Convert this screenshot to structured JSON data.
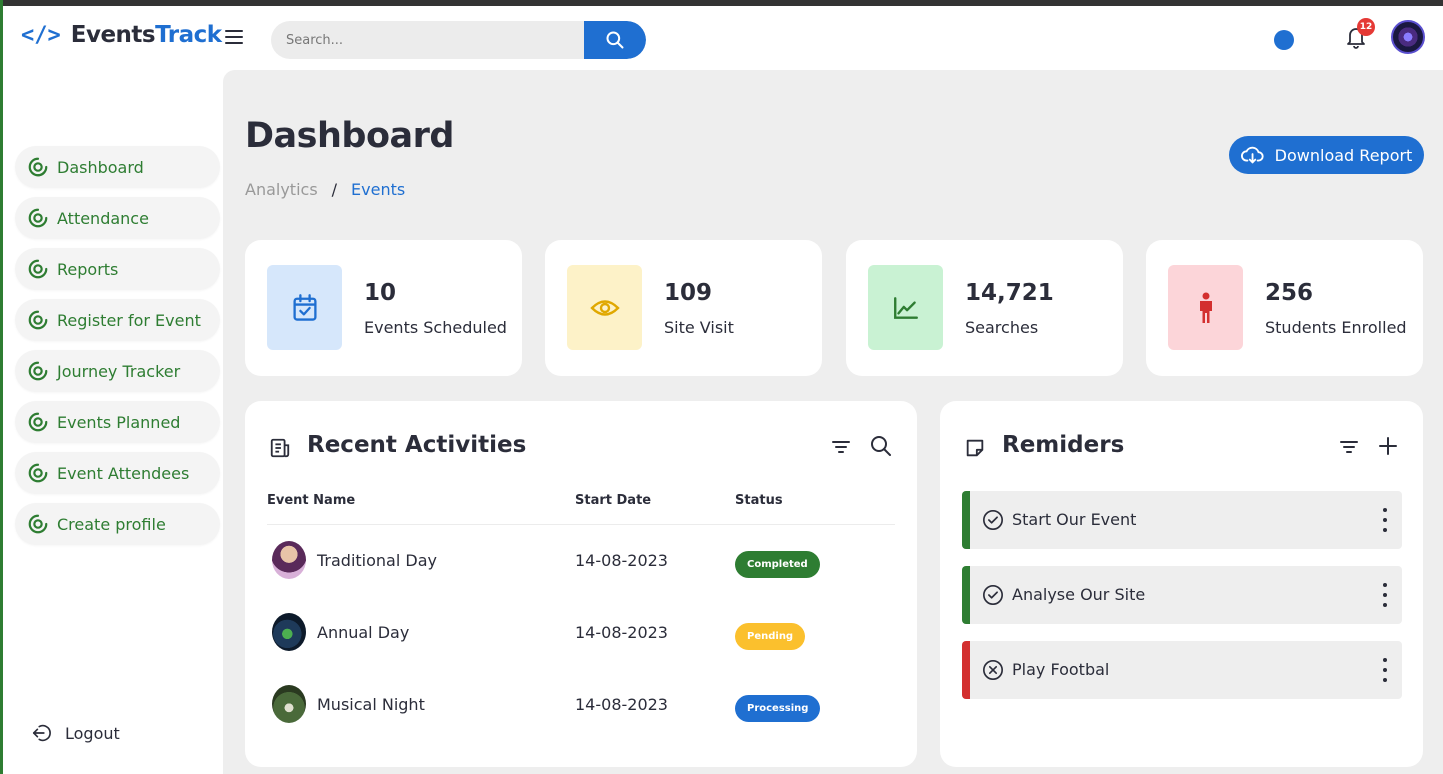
{
  "brand": {
    "icon": "</>",
    "name_main": "Events",
    "name_accent": "Track"
  },
  "header": {
    "search_placeholder": "Search...",
    "notification_count": "12",
    "status_dot_color": "#1f6fd1"
  },
  "sidebar": {
    "items": [
      {
        "label": "Dashboard",
        "icon": "ring-target-icon"
      },
      {
        "label": "Attendance",
        "icon": "ring-target-icon"
      },
      {
        "label": "Reports",
        "icon": "ring-target-icon"
      },
      {
        "label": "Register for Event",
        "icon": "ring-target-icon"
      },
      {
        "label": "Journey Tracker",
        "icon": "ring-target-icon"
      },
      {
        "label": "Events Planned",
        "icon": "ring-target-icon"
      },
      {
        "label": "Event Attendees",
        "icon": "ring-target-icon"
      },
      {
        "label": "Create profile",
        "icon": "ring-target-icon"
      }
    ],
    "logout": "Logout"
  },
  "page": {
    "title": "Dashboard",
    "breadcrumb": [
      "Analytics",
      "/",
      "Events"
    ],
    "download_label": "Download Report"
  },
  "stats": [
    {
      "value": "10",
      "label": "Events Scheduled",
      "icon": "calendar-check-icon",
      "color": "#d6e7fb",
      "icon_color": "#1f6fd1"
    },
    {
      "value": "109",
      "label": "Site Visit",
      "icon": "eye-icon",
      "color": "#fdf2c8",
      "icon_color": "#e0a800"
    },
    {
      "value": "14,721",
      "label": "Searches",
      "icon": "trend-chart-icon",
      "color": "#c9f2d3",
      "icon_color": "#2e7d32"
    },
    {
      "value": "256",
      "label": "Students Enrolled",
      "icon": "person-icon",
      "color": "#fcd5d9",
      "icon_color": "#d32f2f"
    }
  ],
  "activities": {
    "title": "Recent Activities",
    "columns": [
      "Event Name",
      "Start Date",
      "Status"
    ],
    "rows": [
      {
        "name": "Traditional Day",
        "date": "14-08-2023",
        "status": "Completed",
        "status_color": "#2e7d32",
        "status_text_color": "#ffffff"
      },
      {
        "name": "Annual Day",
        "date": "14-08-2023",
        "status": "Pending",
        "status_color": "#fbc02d",
        "status_text_color": "#ffffff"
      },
      {
        "name": "Musical Night",
        "date": "14-08-2023",
        "status": "Processing",
        "status_color": "#1f6fd1",
        "status_text_color": "#ffffff"
      }
    ]
  },
  "reminders": {
    "title": "Remiders",
    "items": [
      {
        "text": "Start Our Event",
        "bar_color": "#2e7d32",
        "icon": "check-circle-icon"
      },
      {
        "text": "Analyse Our Site",
        "bar_color": "#2e7d32",
        "icon": "check-circle-icon"
      },
      {
        "text": "Play Footbal",
        "bar_color": "#d32f2f",
        "icon": "x-circle-icon"
      }
    ]
  }
}
